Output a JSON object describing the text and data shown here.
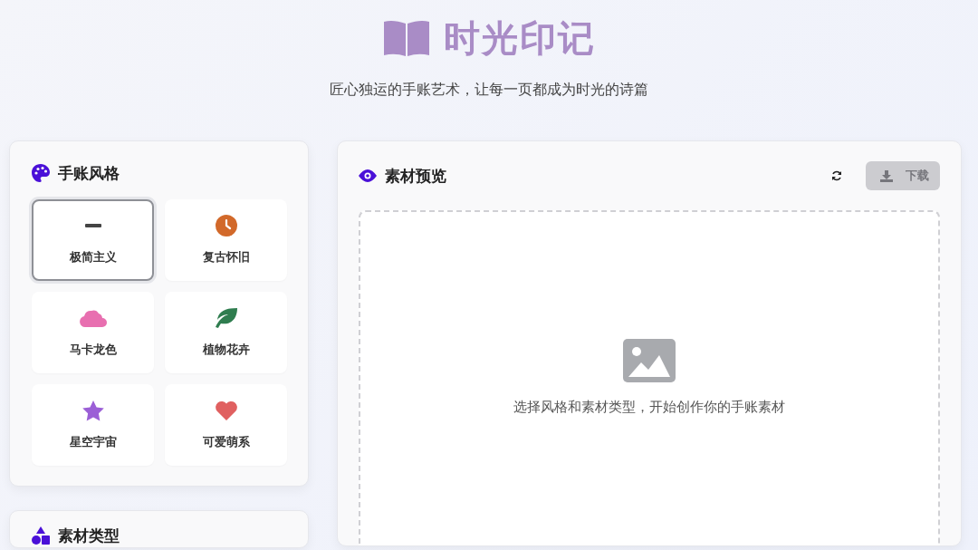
{
  "header": {
    "title": "时光印记",
    "subtitle": "匠心独运的手账艺术，让每一页都成为时光的诗篇"
  },
  "style_panel": {
    "title": "手账风格",
    "styles": [
      {
        "label": "极简主义",
        "kind": "minus",
        "selected": true
      },
      {
        "label": "复古怀旧",
        "kind": "clock",
        "selected": false
      },
      {
        "label": "马卡龙色",
        "kind": "cloud",
        "selected": false
      },
      {
        "label": "植物花卉",
        "kind": "leaf",
        "selected": false
      },
      {
        "label": "星空宇宙",
        "kind": "star",
        "selected": false
      },
      {
        "label": "可爱萌系",
        "kind": "heart",
        "selected": false
      }
    ]
  },
  "type_panel": {
    "title": "素材类型"
  },
  "preview": {
    "title": "素材预览",
    "download": {
      "label": "下载",
      "disabled": true
    },
    "empty_text": "选择风格和素材类型，开始创作你的手账素材"
  }
}
